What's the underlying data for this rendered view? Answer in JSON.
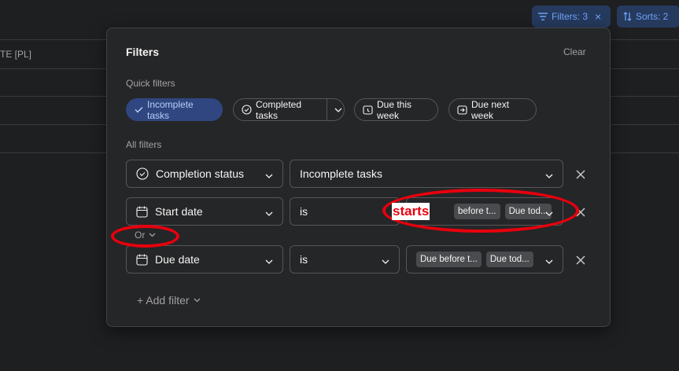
{
  "background": {
    "header_text": "TE [PL]"
  },
  "topbar": {
    "filters_label": "Filters: 3",
    "sorts_label": "Sorts: 2"
  },
  "panel": {
    "title": "Filters",
    "clear_label": "Clear",
    "quick_filters_label": "Quick filters",
    "quick_filters": [
      {
        "label": "Incomplete tasks",
        "active": true
      },
      {
        "label": "Completed tasks",
        "active": false
      },
      {
        "label": "Due this week",
        "active": false
      },
      {
        "label": "Due next week",
        "active": false
      }
    ],
    "all_filters_label": "All filters",
    "rows": [
      {
        "field": "Completion status",
        "operator": "",
        "value": "Incomplete tasks"
      },
      {
        "field": "Start date",
        "operator": "is",
        "tags": [
          "before t...",
          "Due tod..."
        ]
      },
      {
        "field": "Due date",
        "operator": "is",
        "tags": [
          "Due before t...",
          "Due tod..."
        ]
      }
    ],
    "connector_label": "Or",
    "add_filter_label": "+ Add filter"
  },
  "annotation": {
    "text": "starts",
    "color": "#e8000d"
  },
  "colors": {
    "accent": "#6ea3f7",
    "active_chip": "#2f4680",
    "panel_bg": "#252628",
    "page_bg": "#1e1f21"
  }
}
